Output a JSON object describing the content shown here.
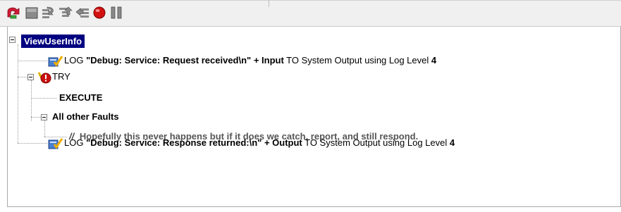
{
  "toolbar": {
    "buttons": [
      {
        "name": "back-icon",
        "label": "Back"
      },
      {
        "name": "stop-square-icon",
        "label": "Stop"
      },
      {
        "name": "step-over-icon",
        "label": "Step Over"
      },
      {
        "name": "step-into-icon",
        "label": "Step Into"
      },
      {
        "name": "step-out-icon",
        "label": "Step Out"
      },
      {
        "name": "breakpoint-icon",
        "label": "Breakpoint"
      },
      {
        "name": "pause-icon",
        "label": "Pause"
      }
    ]
  },
  "tree": {
    "root": "ViewUserInfo",
    "log1": {
      "prefix": "LOG ",
      "expr": "\"Debug: Service: Request received\\n\" + Input",
      "middle": "  TO System Output using Log Level ",
      "level": "4"
    },
    "try": {
      "label": "TRY"
    },
    "execute": {
      "label": "EXECUTE"
    },
    "faults": {
      "label": "All other Faults"
    },
    "comment": {
      "marker": "//",
      "text": "Hopefully this never happens but if it does we catch, report, and still respond."
    },
    "log2": {
      "prefix": "LOG ",
      "expr": "\"Debug: Service: Response returned:\\n\" + Output",
      "middle": " TO System Output using Log Level ",
      "level": "4"
    }
  },
  "colors": {
    "selection": "#000080",
    "toolbar_bg": "#f0f0f0",
    "green_arrow": "#d21b36",
    "stop_red": "#cc1111"
  }
}
